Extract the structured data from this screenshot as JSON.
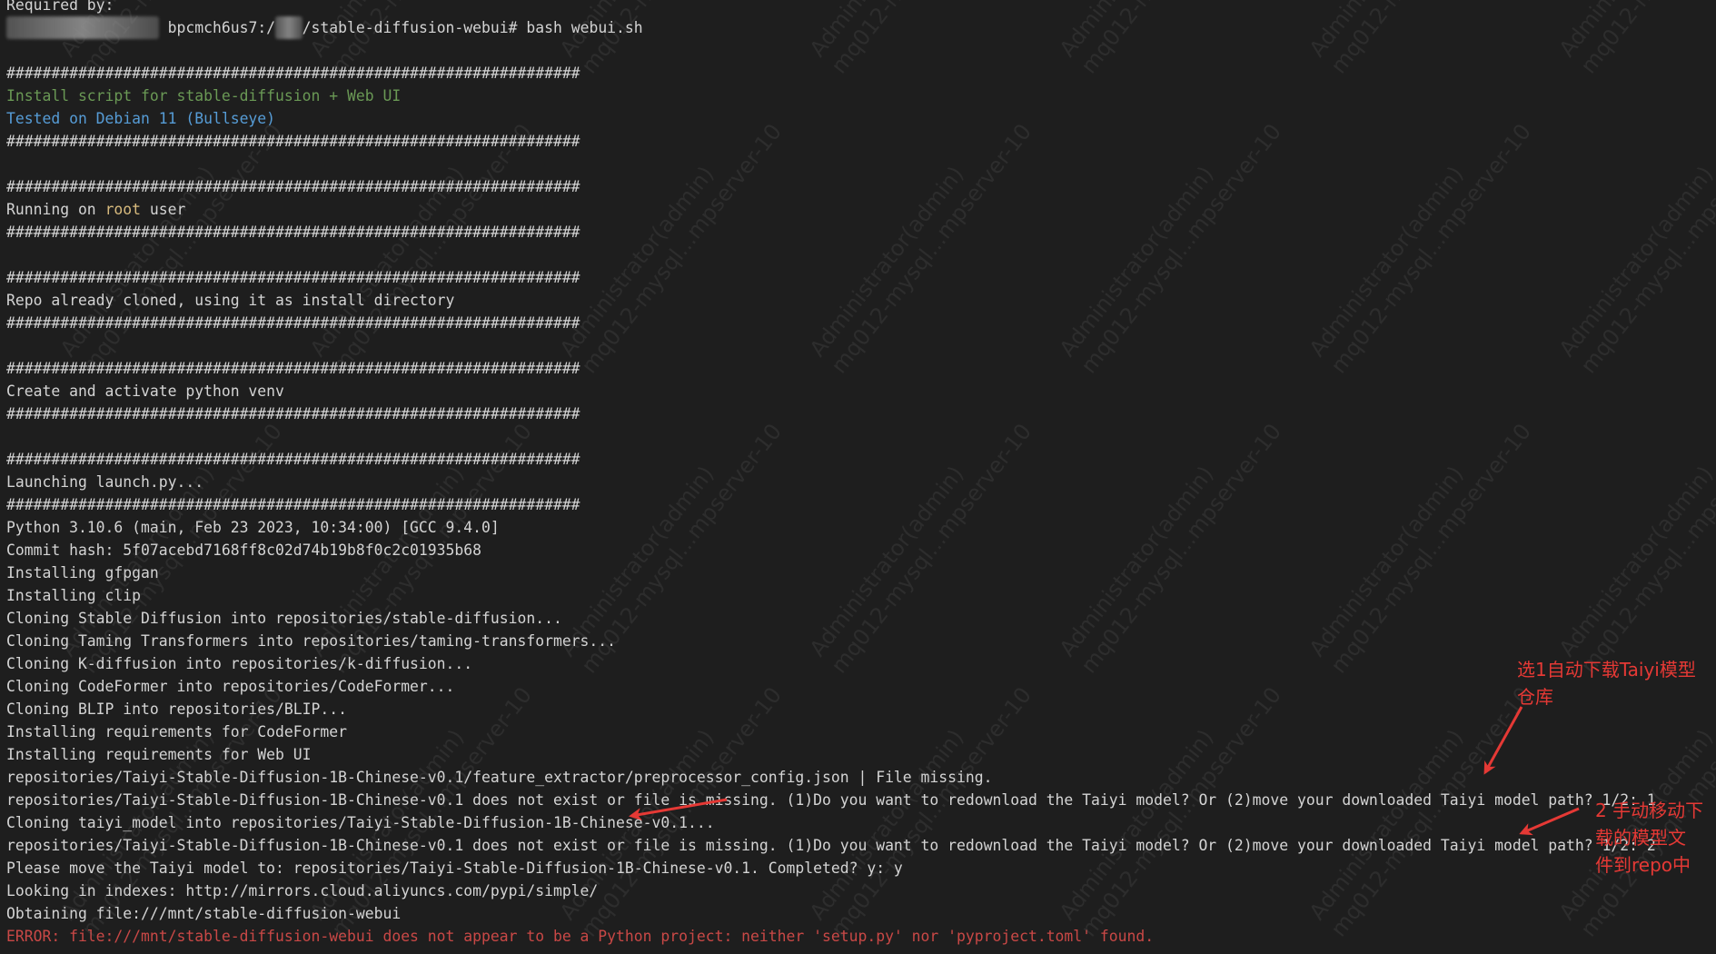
{
  "terminal": {
    "lines": [
      {
        "segments": [
          {
            "text": "Required by:",
            "style": ""
          }
        ]
      },
      {
        "segments": [
          {
            "text": "root@izjuc0s9svif",
            "style": "blur"
          },
          {
            "text": " bpcmch6us7:/",
            "style": ""
          },
          {
            "text": "mnt",
            "style": "blur"
          },
          {
            "text": "/stable-diffusion-webui# bash webui.sh",
            "style": ""
          }
        ]
      },
      {
        "segments": []
      },
      {
        "segments": [
          {
            "text": "################################################################",
            "style": ""
          }
        ]
      },
      {
        "segments": [
          {
            "text": "Install script for stable-diffusion + Web UI",
            "style": "c-green"
          }
        ]
      },
      {
        "segments": [
          {
            "text": "Tested on Debian 11 (Bullseye)",
            "style": "c-blue"
          }
        ]
      },
      {
        "segments": [
          {
            "text": "################################################################",
            "style": ""
          }
        ]
      },
      {
        "segments": []
      },
      {
        "segments": [
          {
            "text": "################################################################",
            "style": ""
          }
        ]
      },
      {
        "segments": [
          {
            "text": "Running on ",
            "style": ""
          },
          {
            "text": "root",
            "style": "c-gold"
          },
          {
            "text": " user",
            "style": ""
          }
        ]
      },
      {
        "segments": [
          {
            "text": "################################################################",
            "style": ""
          }
        ]
      },
      {
        "segments": []
      },
      {
        "segments": [
          {
            "text": "################################################################",
            "style": ""
          }
        ]
      },
      {
        "segments": [
          {
            "text": "Repo already cloned, using it as install directory",
            "style": ""
          }
        ]
      },
      {
        "segments": [
          {
            "text": "################################################################",
            "style": ""
          }
        ]
      },
      {
        "segments": []
      },
      {
        "segments": [
          {
            "text": "################################################################",
            "style": ""
          }
        ]
      },
      {
        "segments": [
          {
            "text": "Create and activate python venv",
            "style": ""
          }
        ]
      },
      {
        "segments": [
          {
            "text": "################################################################",
            "style": ""
          }
        ]
      },
      {
        "segments": []
      },
      {
        "segments": [
          {
            "text": "################################################################",
            "style": ""
          }
        ]
      },
      {
        "segments": [
          {
            "text": "Launching launch.py...",
            "style": ""
          }
        ]
      },
      {
        "segments": [
          {
            "text": "################################################################",
            "style": ""
          }
        ]
      },
      {
        "segments": [
          {
            "text": "Python 3.10.6 (main, Feb 23 2023, 10:34:00) [GCC 9.4.0]",
            "style": ""
          }
        ]
      },
      {
        "segments": [
          {
            "text": "Commit hash: 5f07acebd7168ff8c02d74b19b8f0c2c01935b68",
            "style": ""
          }
        ]
      },
      {
        "segments": [
          {
            "text": "Installing gfpgan",
            "style": ""
          }
        ]
      },
      {
        "segments": [
          {
            "text": "Installing clip",
            "style": ""
          }
        ]
      },
      {
        "segments": [
          {
            "text": "Cloning Stable Diffusion into repositories/stable-diffusion...",
            "style": ""
          }
        ]
      },
      {
        "segments": [
          {
            "text": "Cloning Taming Transformers into repositories/taming-transformers...",
            "style": ""
          }
        ]
      },
      {
        "segments": [
          {
            "text": "Cloning K-diffusion into repositories/k-diffusion...",
            "style": ""
          }
        ]
      },
      {
        "segments": [
          {
            "text": "Cloning CodeFormer into repositories/CodeFormer...",
            "style": ""
          }
        ]
      },
      {
        "segments": [
          {
            "text": "Cloning BLIP into repositories/BLIP...",
            "style": ""
          }
        ]
      },
      {
        "segments": [
          {
            "text": "Installing requirements for CodeFormer",
            "style": ""
          }
        ]
      },
      {
        "segments": [
          {
            "text": "Installing requirements for Web UI",
            "style": ""
          }
        ]
      },
      {
        "segments": [
          {
            "text": "repositories/Taiyi-Stable-Diffusion-1B-Chinese-v0.1/feature_extractor/preprocessor_config.json | File missing.",
            "style": ""
          }
        ]
      },
      {
        "segments": [
          {
            "text": "repositories/Taiyi-Stable-Diffusion-1B-Chinese-v0.1 does not exist or file is missing. (1)Do you want to redownload the Taiyi model? Or (2)move your downloaded Taiyi model path? 1/2: 1",
            "style": ""
          }
        ]
      },
      {
        "segments": [
          {
            "text": "Cloning taiyi_model into repositories/Taiyi-Stable-Diffusion-1B-Chinese-v0.1...",
            "style": ""
          }
        ]
      },
      {
        "segments": [
          {
            "text": "repositories/Taiyi-Stable-Diffusion-1B-Chinese-v0.1 does not exist or file is missing. (1)Do you want to redownload the Taiyi model? Or (2)move your downloaded Taiyi model path? 1/2: 2",
            "style": ""
          }
        ]
      },
      {
        "segments": [
          {
            "text": "Please move the Taiyi model to: repositories/Taiyi-Stable-Diffusion-1B-Chinese-v0.1. Completed? y: y",
            "style": ""
          }
        ]
      },
      {
        "segments": [
          {
            "text": "Looking in indexes: http://mirrors.cloud.aliyuncs.com/pypi/simple/",
            "style": ""
          }
        ]
      },
      {
        "segments": [
          {
            "text": "Obtaining file:///mnt/stable-diffusion-webui",
            "style": ""
          }
        ]
      },
      {
        "segments": [
          {
            "text": "ERROR: file:///mnt/stable-diffusion-webui does not appear to be a Python project: neither 'setup.py' nor 'pyproject.toml' found.",
            "style": "c-error"
          }
        ]
      }
    ]
  },
  "annotations": {
    "note1": [
      "选1自动下载Taiyi模型",
      "仓库"
    ],
    "note2": [
      "2 手动移动下",
      "载的模型文",
      "件到repo中"
    ],
    "color": "#e53935"
  },
  "watermark": {
    "line1": "Administrator(admin)",
    "line2": "mq012-mysql...mpserver-10"
  },
  "colors": {
    "background": "#1e1e1e",
    "text": "#d4d4d4",
    "green": "#6a9955",
    "blue": "#569cd6",
    "gold": "#d7ba7d",
    "error": "#c94846"
  }
}
